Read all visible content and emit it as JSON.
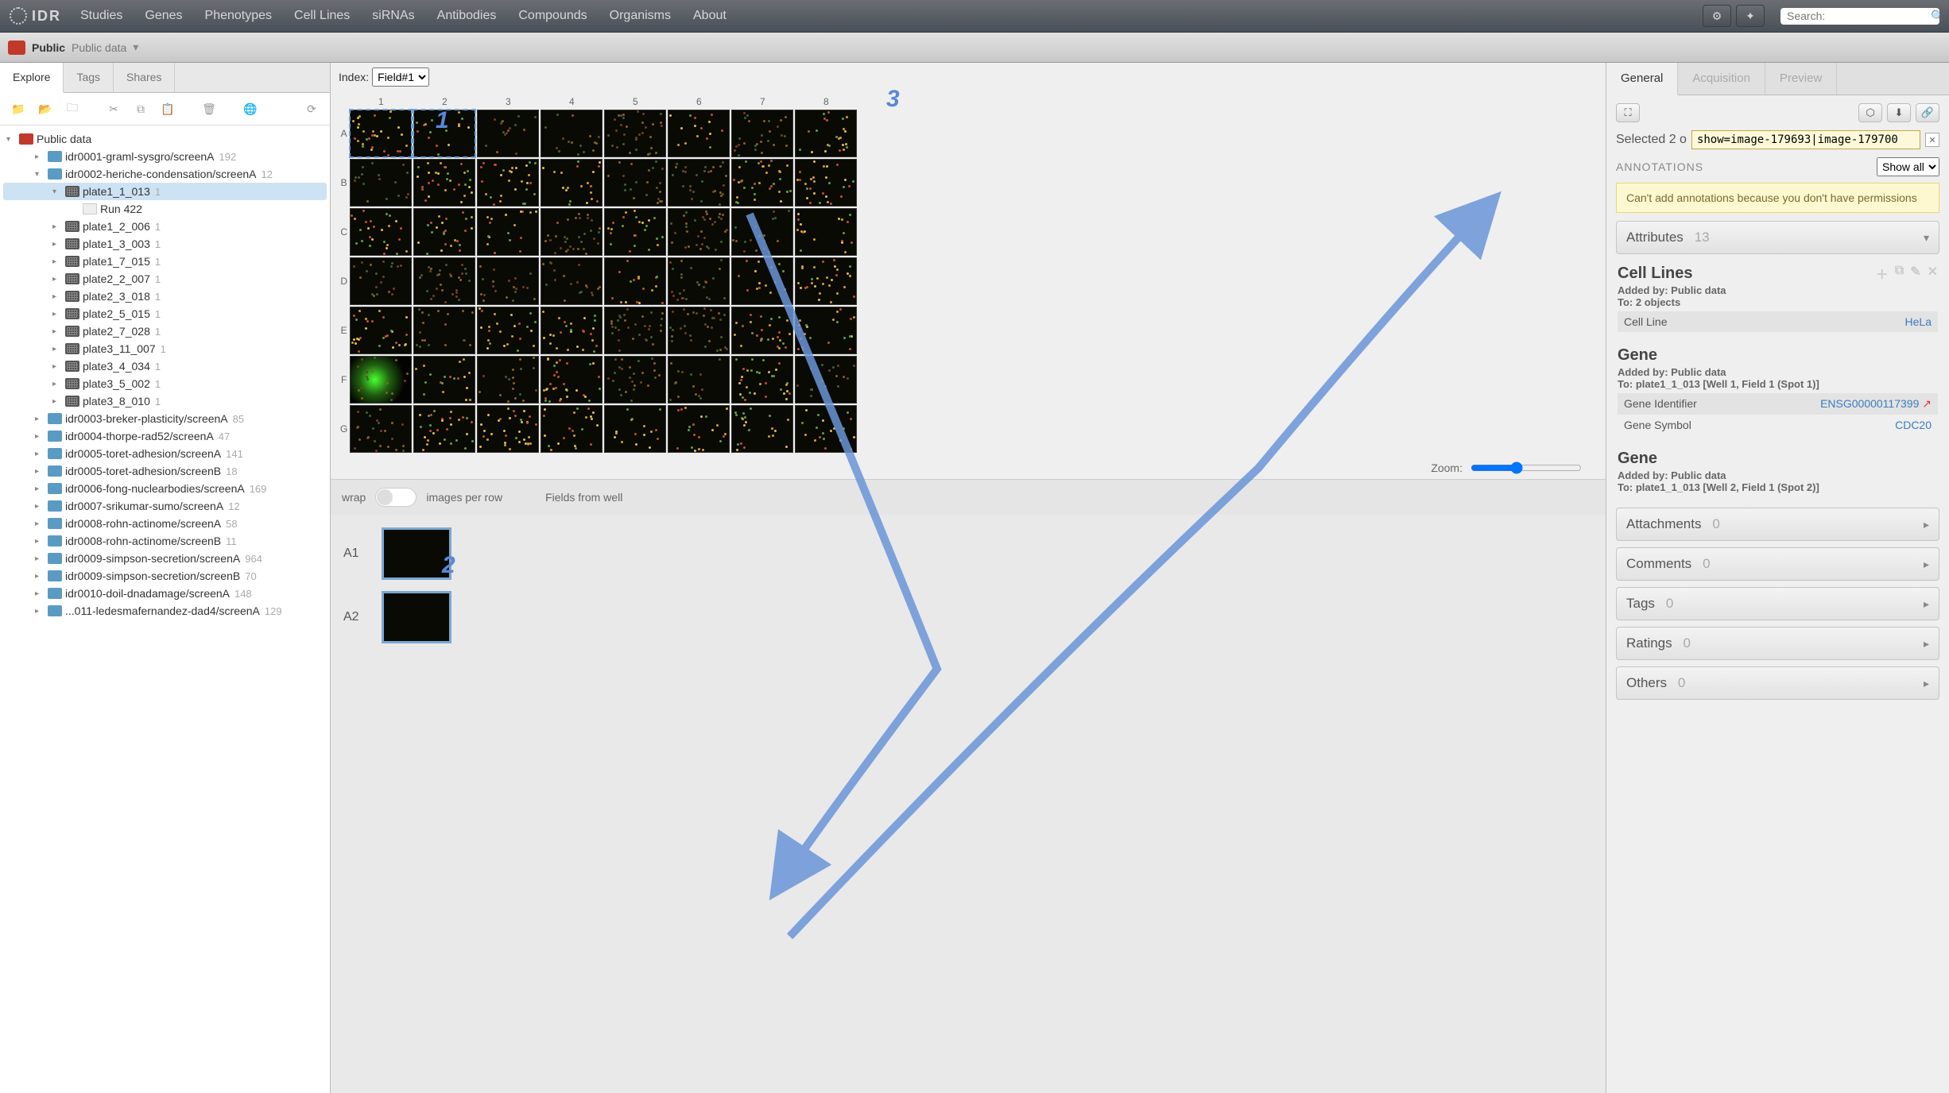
{
  "nav": {
    "logo": "IDR",
    "links": [
      "Studies",
      "Genes",
      "Phenotypes",
      "Cell Lines",
      "siRNAs",
      "Antibodies",
      "Compounds",
      "Organisms",
      "About"
    ],
    "search_placeholder": "Search:"
  },
  "context": {
    "title": "Public",
    "subtitle": "Public data"
  },
  "left": {
    "tabs": [
      "Explore",
      "Tags",
      "Shares"
    ],
    "active_tab": 0,
    "root": {
      "label": "Public data"
    },
    "items": [
      {
        "indent": 2,
        "type": "folder",
        "label": "idr0001-graml-sysgro/screenA",
        "count": "192"
      },
      {
        "indent": 2,
        "type": "folder",
        "label": "idr0002-heriche-condensation/screenA",
        "count": "12",
        "expanded": true
      },
      {
        "indent": 3,
        "type": "plate",
        "label": "plate1_1_013",
        "count": "1",
        "selected": true,
        "expanded": true
      },
      {
        "indent": 4,
        "type": "run",
        "label": "Run 422"
      },
      {
        "indent": 3,
        "type": "plate",
        "label": "plate1_2_006",
        "count": "1"
      },
      {
        "indent": 3,
        "type": "plate",
        "label": "plate1_3_003",
        "count": "1"
      },
      {
        "indent": 3,
        "type": "plate",
        "label": "plate1_7_015",
        "count": "1"
      },
      {
        "indent": 3,
        "type": "plate",
        "label": "plate2_2_007",
        "count": "1"
      },
      {
        "indent": 3,
        "type": "plate",
        "label": "plate2_3_018",
        "count": "1"
      },
      {
        "indent": 3,
        "type": "plate",
        "label": "plate2_5_015",
        "count": "1"
      },
      {
        "indent": 3,
        "type": "plate",
        "label": "plate2_7_028",
        "count": "1"
      },
      {
        "indent": 3,
        "type": "plate",
        "label": "plate3_11_007",
        "count": "1"
      },
      {
        "indent": 3,
        "type": "plate",
        "label": "plate3_4_034",
        "count": "1"
      },
      {
        "indent": 3,
        "type": "plate",
        "label": "plate3_5_002",
        "count": "1"
      },
      {
        "indent": 3,
        "type": "plate",
        "label": "plate3_8_010",
        "count": "1"
      },
      {
        "indent": 2,
        "type": "folder",
        "label": "idr0003-breker-plasticity/screenA",
        "count": "85"
      },
      {
        "indent": 2,
        "type": "folder",
        "label": "idr0004-thorpe-rad52/screenA",
        "count": "47"
      },
      {
        "indent": 2,
        "type": "folder",
        "label": "idr0005-toret-adhesion/screenA",
        "count": "141"
      },
      {
        "indent": 2,
        "type": "folder",
        "label": "idr0005-toret-adhesion/screenB",
        "count": "18"
      },
      {
        "indent": 2,
        "type": "folder",
        "label": "idr0006-fong-nuclearbodies/screenA",
        "count": "169"
      },
      {
        "indent": 2,
        "type": "folder",
        "label": "idr0007-srikumar-sumo/screenA",
        "count": "12"
      },
      {
        "indent": 2,
        "type": "folder",
        "label": "idr0008-rohn-actinome/screenA",
        "count": "58"
      },
      {
        "indent": 2,
        "type": "folder",
        "label": "idr0008-rohn-actinome/screenB",
        "count": "11"
      },
      {
        "indent": 2,
        "type": "folder",
        "label": "idr0009-simpson-secretion/screenA",
        "count": "964"
      },
      {
        "indent": 2,
        "type": "folder",
        "label": "idr0009-simpson-secretion/screenB",
        "count": "70"
      },
      {
        "indent": 2,
        "type": "folder",
        "label": "idr0010-doil-dnadamage/screenA",
        "count": "148"
      },
      {
        "indent": 2,
        "type": "folder",
        "label": "...011-ledesmafernandez-dad4/screenA",
        "count": "129"
      }
    ]
  },
  "center": {
    "index_label": "Index:",
    "index_value": "Field#1",
    "cols": [
      "1",
      "2",
      "3",
      "4",
      "5",
      "6",
      "7",
      "8"
    ],
    "rows": [
      "A",
      "B",
      "C",
      "D",
      "E",
      "F",
      "G"
    ],
    "zoom_label": "Zoom:",
    "wrap_label": "wrap",
    "images_per_row": "images per row",
    "fields_label": "Fields from well",
    "field_thumbs": [
      "A1",
      "A2"
    ]
  },
  "right": {
    "tabs": [
      "General",
      "Acquisition",
      "Preview"
    ],
    "active_tab": 0,
    "selected_text": "Selected 2 o",
    "link_value": "show=image-179693|image-179700",
    "annotations_label": "ANNOTATIONS",
    "show_all": "Show all",
    "warn": "Can't add annotations because you don't have permissions",
    "attributes": {
      "label": "Attributes",
      "count": "13"
    },
    "cell_lines": {
      "title": "Cell Lines",
      "meta1": "Added by: Public data",
      "meta2": "To: 2 objects",
      "rows": [
        {
          "k": "Cell Line",
          "v": "HeLa"
        }
      ]
    },
    "gene1": {
      "title": "Gene",
      "meta1": "Added by: Public data",
      "meta2": "To: plate1_1_013 [Well 1, Field 1 (Spot 1)]",
      "rows": [
        {
          "k": "Gene Identifier",
          "v": "ENSG00000117399",
          "ext": true
        },
        {
          "k": "Gene Symbol",
          "v": "CDC20"
        }
      ]
    },
    "gene2": {
      "title": "Gene",
      "meta1": "Added by: Public data",
      "meta2": "To: plate1_1_013 [Well 2, Field 1 (Spot 2)]"
    },
    "sections": [
      {
        "name": "Attachments",
        "count": "0"
      },
      {
        "name": "Comments",
        "count": "0"
      },
      {
        "name": "Tags",
        "count": "0"
      },
      {
        "name": "Ratings",
        "count": "0"
      },
      {
        "name": "Others",
        "count": "0"
      }
    ]
  },
  "annotations": {
    "n1": "1",
    "n2": "2",
    "n3": "3"
  }
}
